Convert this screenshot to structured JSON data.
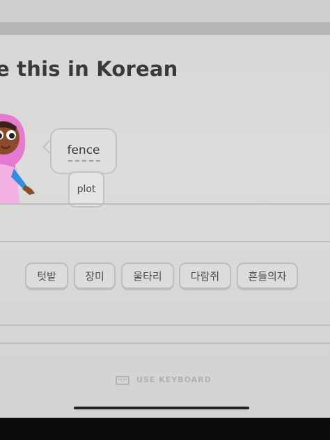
{
  "prompt": {
    "title": "e this in Korean"
  },
  "bubble": {
    "word": "fence"
  },
  "tooltip": {
    "hint": "plot"
  },
  "word_bank": [
    "텃밭",
    "장미",
    "울타리",
    "다람쥐",
    "흔들의자"
  ],
  "footer": {
    "keyboard_label": "USE KEYBOARD"
  },
  "colors": {
    "character_hijab": "#e47bd0",
    "character_skin": "#8a4a2b",
    "character_sleeve": "#2f8ee0"
  }
}
